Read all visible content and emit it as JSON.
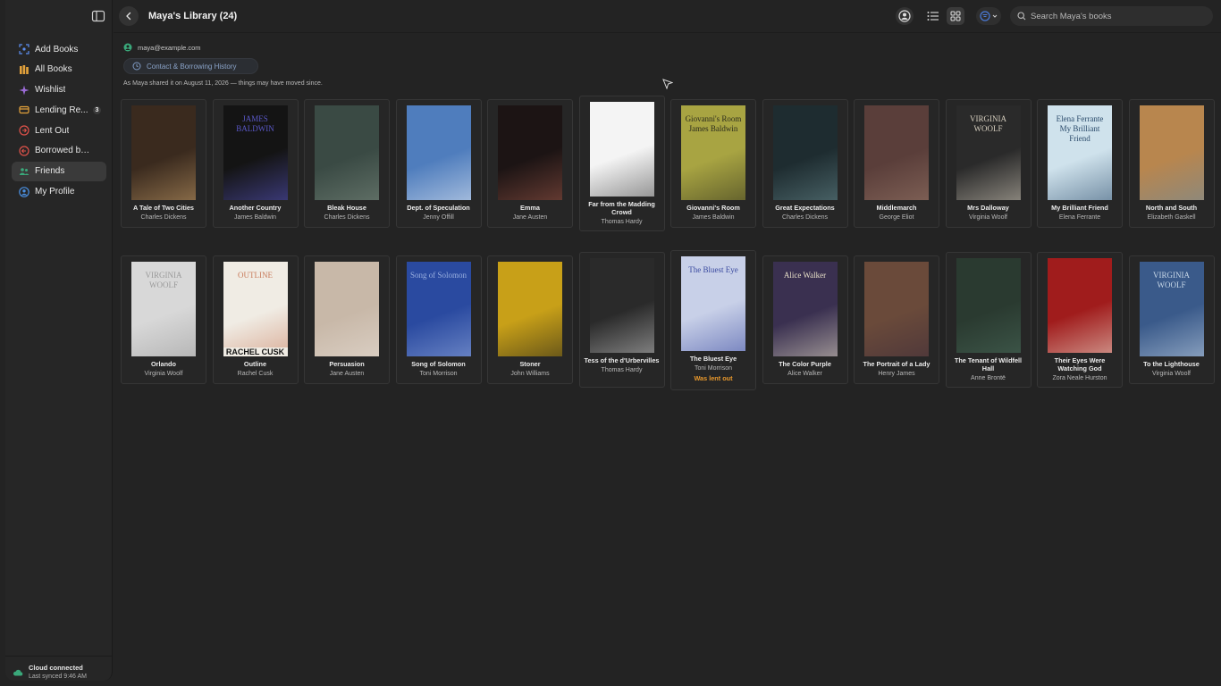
{
  "window": {
    "title": "Maya's Library (24)"
  },
  "sidebar": {
    "items": [
      {
        "label": "Add Books",
        "icon": "scan-icon",
        "color": "#5b8def"
      },
      {
        "label": "All Books",
        "icon": "books-icon",
        "color": "#e4a23b"
      },
      {
        "label": "Wishlist",
        "icon": "sparkle-icon",
        "color": "#9b6bd6"
      },
      {
        "label": "Lending Re...",
        "icon": "lending-icon",
        "color": "#e4a23b",
        "badge": "3"
      },
      {
        "label": "Lent Out",
        "icon": "lent-icon",
        "color": "#e0524a"
      },
      {
        "label": "Borrowed by Me",
        "icon": "borrowed-icon",
        "color": "#e0524a"
      },
      {
        "label": "Friends",
        "icon": "friends-icon",
        "color": "#3aa87a",
        "active": true
      },
      {
        "label": "My Profile",
        "icon": "profile-icon",
        "color": "#4a8fe0"
      }
    ],
    "sync": {
      "title": "Cloud connected",
      "subtitle": "Last synced 9:46 AM"
    }
  },
  "toolbar": {
    "search_placeholder": "Search Maya's books"
  },
  "header": {
    "email": "maya@example.com",
    "contact_label": "Contact & Borrowing History",
    "shared_note": "As Maya shared it on August 11, 2026 — things may have moved since."
  },
  "books": [
    {
      "title": "A Tale of Two Cities",
      "author": "Charles Dickens",
      "bg": "#3a2a1e",
      "accent": "#c8a06a"
    },
    {
      "title": "Another Country",
      "author": "James Baldwin",
      "bg": "#141414",
      "accent": "#5a58c8",
      "cover_text": "JAMES BALDWIN"
    },
    {
      "title": "Bleak House",
      "author": "Charles Dickens",
      "bg": "#3a4a44",
      "accent": "#7d8c80"
    },
    {
      "title": "Dept. of Speculation",
      "author": "Jenny Offill",
      "bg": "#4f7dbd",
      "accent": "#e8eef6"
    },
    {
      "title": "Emma",
      "author": "Jane Austen",
      "bg": "#1c1414",
      "accent": "#a05a4a"
    },
    {
      "title": "Far from the Madding Crowd",
      "author": "Thomas Hardy",
      "bg": "#f4f4f4",
      "accent": "#444444"
    },
    {
      "title": "Giovanni's Room",
      "author": "James Baldwin",
      "bg": "#a8a442",
      "accent": "#2c2c1c",
      "cover_text": "Giovanni's Room James Baldwin"
    },
    {
      "title": "Great Expectations",
      "author": "Charles Dickens",
      "bg": "#1e2c30",
      "accent": "#6a8c90"
    },
    {
      "title": "Middlemarch",
      "author": "George Eliot",
      "bg": "#5a3e3a",
      "accent": "#9a7a6a"
    },
    {
      "title": "Mrs Dalloway",
      "author": "Virginia Woolf",
      "bg": "#2a2a2a",
      "accent": "#d8d0c0",
      "cover_text": "VIRGINIA WOOLF"
    },
    {
      "title": "My Brilliant Friend",
      "author": "Elena Ferrante",
      "bg": "#cfe2ec",
      "accent": "#2a4a6a",
      "cover_text": "Elena Ferrante My Brilliant Friend"
    },
    {
      "title": "North and South",
      "author": "Elizabeth Gaskell",
      "bg": "#b8864e",
      "accent": "#6a8aa0"
    },
    {
      "title": "Orlando",
      "author": "Virginia Woolf",
      "bg": "#d8d8d8",
      "accent": "#9a9a9a",
      "cover_text": "VIRGINIA WOOLF"
    },
    {
      "title": "Outline",
      "author": "Rachel Cusk",
      "bg": "#f0ece4",
      "accent": "#c87a5a",
      "cover_text": "OUTLINE",
      "cover_text2": "RACHEL CUSK"
    },
    {
      "title": "Persuasion",
      "author": "Jane Austen",
      "bg": "#c8b8a8",
      "accent": "#e8e0d8"
    },
    {
      "title": "Song of Solomon",
      "author": "Toni Morrison",
      "bg": "#2a4aa0",
      "accent": "#9ab0e0",
      "cover_text": "Song of Solomon"
    },
    {
      "title": "Stoner",
      "author": "John Williams",
      "bg": "#c8a018",
      "accent": "#1a1a1a"
    },
    {
      "title": "Tess of the d'Urbervilles",
      "author": "Thomas Hardy",
      "bg": "#2a2a2a",
      "accent": "#c8c8c8"
    },
    {
      "title": "The Bluest Eye",
      "author": "Toni Morrison",
      "bg": "#c8d0e8",
      "accent": "#3a4aa0",
      "cover_text": "The Bluest Eye",
      "status": "Was lent out"
    },
    {
      "title": "The Color Purple",
      "author": "Alice Walker",
      "bg": "#3a3050",
      "accent": "#e8e0c8",
      "cover_text": "Alice Walker"
    },
    {
      "title": "The Portrait of a Lady",
      "author": "Henry James",
      "bg": "#6a4a3a",
      "accent": "#3a2a3a"
    },
    {
      "title": "The Tenant of Wildfell Hall",
      "author": "Anne Brontë",
      "bg": "#2a3a30",
      "accent": "#4a6a5a"
    },
    {
      "title": "Their Eyes Were Watching God",
      "author": "Zora Neale Hurston",
      "bg": "#a01c1c",
      "accent": "#f0e8d8"
    },
    {
      "title": "To the Lighthouse",
      "author": "Virginia Woolf",
      "bg": "#3a5a8a",
      "accent": "#c8d8e8",
      "cover_text": "VIRGINIA WOOLF"
    }
  ]
}
